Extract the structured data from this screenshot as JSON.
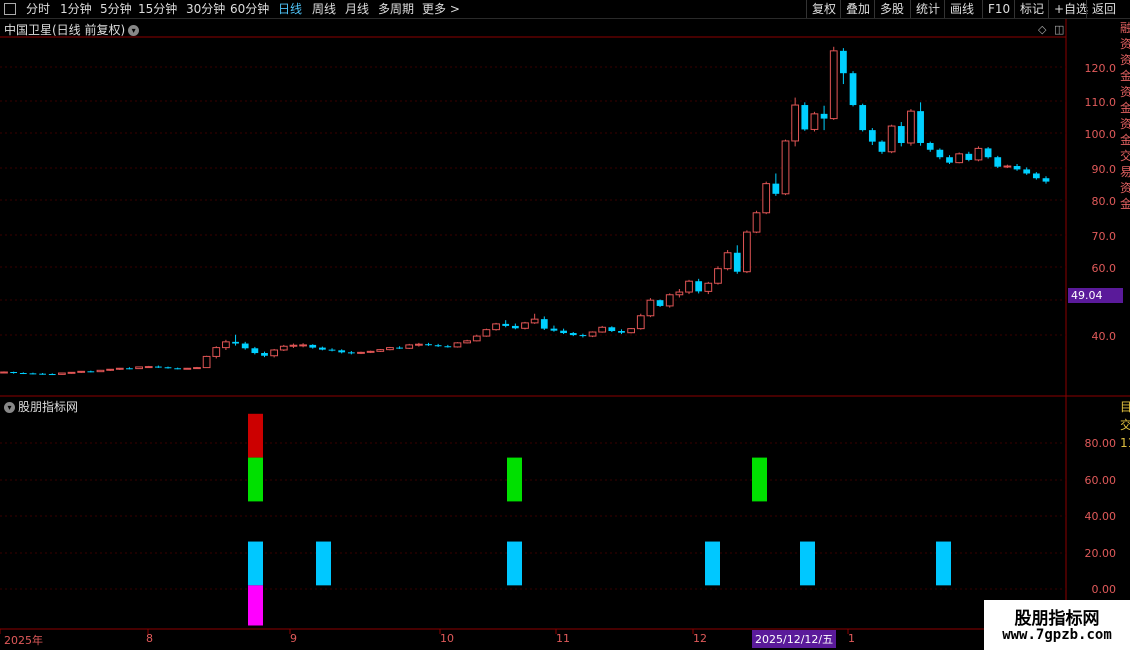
{
  "toolbar": {
    "periods": [
      "分时",
      "1分钟",
      "5分钟",
      "15分钟",
      "30分钟",
      "60分钟",
      "日线",
      "周线",
      "月线",
      "多周期",
      "更多 >"
    ],
    "active_period": "日线",
    "right_buttons": [
      "复权",
      "叠加",
      "多股",
      "统计",
      "画线",
      "F10",
      "标记",
      "+自选",
      "返回"
    ]
  },
  "main_title": "中国卫星(日线 前复权)",
  "price_labels": [
    "120.0",
    "110.0",
    "100.0",
    "90.0",
    "80.0",
    "70.0",
    "60.0",
    "40.0"
  ],
  "current_price": "49.04",
  "indicator_title": "股朋指标网",
  "indicator_labels": [
    "80.00",
    "60.00",
    "40.00",
    "20.00",
    "0.00"
  ],
  "x_labels": [
    "2025年",
    "8",
    "9",
    "10",
    "11",
    "12",
    "1"
  ],
  "x_date_badge": "2025/12/12/五",
  "side_chars": "融资资金资金资金交易资金",
  "side_chars2": "目交1111111",
  "watermark": {
    "line1": "股朋指标网",
    "line2": "www.7gpzb.com"
  },
  "colors": {
    "up": "#e05555",
    "down": "#00d0ff",
    "grid": "#3a0000",
    "sep": "#8b0000"
  },
  "chart_data": {
    "type": "candlestick",
    "ylim": [
      30,
      128
    ],
    "candles": [
      [
        29.8,
        30.2,
        29.6,
        30.0
      ],
      [
        30.0,
        30.1,
        29.5,
        29.7
      ],
      [
        29.7,
        29.9,
        29.4,
        29.6
      ],
      [
        29.6,
        29.8,
        29.3,
        29.5
      ],
      [
        29.5,
        29.7,
        29.2,
        29.4
      ],
      [
        29.4,
        29.6,
        29.1,
        29.3
      ],
      [
        29.3,
        29.8,
        29.2,
        29.7
      ],
      [
        29.7,
        30.0,
        29.5,
        29.9
      ],
      [
        29.9,
        30.3,
        29.7,
        30.2
      ],
      [
        30.2,
        30.4,
        29.9,
        30.1
      ],
      [
        30.1,
        30.6,
        30.0,
        30.5
      ],
      [
        30.5,
        30.9,
        30.3,
        30.8
      ],
      [
        30.8,
        31.2,
        30.6,
        31.1
      ],
      [
        31.1,
        31.4,
        30.8,
        31.0
      ],
      [
        31.0,
        31.6,
        30.9,
        31.5
      ],
      [
        31.5,
        31.8,
        31.2,
        31.6
      ],
      [
        31.6,
        31.9,
        31.2,
        31.4
      ],
      [
        31.4,
        31.6,
        31.0,
        31.1
      ],
      [
        31.1,
        31.3,
        30.8,
        31.0
      ],
      [
        31.0,
        31.2,
        30.8,
        31.1
      ],
      [
        31.1,
        31.5,
        30.9,
        31.3
      ],
      [
        31.3,
        34.8,
        31.2,
        34.6
      ],
      [
        34.6,
        37.6,
        34.0,
        37.2
      ],
      [
        37.2,
        39.5,
        36.5,
        38.9
      ],
      [
        38.9,
        41.0,
        37.8,
        38.4
      ],
      [
        38.4,
        38.9,
        36.6,
        37.0
      ],
      [
        37.0,
        37.4,
        35.2,
        35.6
      ],
      [
        35.6,
        36.0,
        34.4,
        34.8
      ],
      [
        34.8,
        36.8,
        34.3,
        36.5
      ],
      [
        36.5,
        38.0,
        36.2,
        37.6
      ],
      [
        37.6,
        38.4,
        37.1,
        37.9
      ],
      [
        37.9,
        38.5,
        37.3,
        38.0
      ],
      [
        38.0,
        38.2,
        36.9,
        37.2
      ],
      [
        37.2,
        37.5,
        36.4,
        36.6
      ],
      [
        36.6,
        37.0,
        36.1,
        36.4
      ],
      [
        36.4,
        36.7,
        35.5,
        35.8
      ],
      [
        35.8,
        36.2,
        35.2,
        35.5
      ],
      [
        35.5,
        36.0,
        35.3,
        35.8
      ],
      [
        35.8,
        36.3,
        35.6,
        36.1
      ],
      [
        36.1,
        36.8,
        35.9,
        36.6
      ],
      [
        36.6,
        37.4,
        36.4,
        37.2
      ],
      [
        37.2,
        37.6,
        36.8,
        37.0
      ],
      [
        37.0,
        38.3,
        36.8,
        38.0
      ],
      [
        38.0,
        38.6,
        37.5,
        38.2
      ],
      [
        38.2,
        38.6,
        37.7,
        37.9
      ],
      [
        37.9,
        38.3,
        37.4,
        37.6
      ],
      [
        37.6,
        38.0,
        37.2,
        37.4
      ],
      [
        37.4,
        38.8,
        37.2,
        38.6
      ],
      [
        38.6,
        39.5,
        38.4,
        39.2
      ],
      [
        39.2,
        41.0,
        39.0,
        40.6
      ],
      [
        40.6,
        42.8,
        40.4,
        42.5
      ],
      [
        42.5,
        44.5,
        42.2,
        44.2
      ],
      [
        44.2,
        45.3,
        43.2,
        43.6
      ],
      [
        43.6,
        44.3,
        42.6,
        42.9
      ],
      [
        42.9,
        44.8,
        42.6,
        44.5
      ],
      [
        44.5,
        47.2,
        44.2,
        45.6
      ],
      [
        45.6,
        46.4,
        42.4,
        42.8
      ],
      [
        42.8,
        43.7,
        41.9,
        42.2
      ],
      [
        42.2,
        42.8,
        41.2,
        41.5
      ],
      [
        41.5,
        41.8,
        40.6,
        40.9
      ],
      [
        40.9,
        41.3,
        40.2,
        40.6
      ],
      [
        40.6,
        42.0,
        40.3,
        41.8
      ],
      [
        41.8,
        43.6,
        41.6,
        43.2
      ],
      [
        43.2,
        43.5,
        41.8,
        42.1
      ],
      [
        42.1,
        42.6,
        41.2,
        41.6
      ],
      [
        41.6,
        43.0,
        41.4,
        42.8
      ],
      [
        42.8,
        47.2,
        42.5,
        46.6
      ],
      [
        46.6,
        51.8,
        46.2,
        51.2
      ],
      [
        51.2,
        51.4,
        49.2,
        49.5
      ],
      [
        49.5,
        53.2,
        49.0,
        52.8
      ],
      [
        52.8,
        54.5,
        52.0,
        53.6
      ],
      [
        53.6,
        57.2,
        53.0,
        56.8
      ],
      [
        56.8,
        57.5,
        53.2,
        53.8
      ],
      [
        53.8,
        56.6,
        53.0,
        56.2
      ],
      [
        56.2,
        61.2,
        55.8,
        60.5
      ],
      [
        60.5,
        66.0,
        60.0,
        65.2
      ],
      [
        65.2,
        67.4,
        59.0,
        59.6
      ],
      [
        59.6,
        71.8,
        59.2,
        71.3
      ],
      [
        71.3,
        77.6,
        71.0,
        77.0
      ],
      [
        77.0,
        86.2,
        76.6,
        85.6
      ],
      [
        85.6,
        88.6,
        82.0,
        82.6
      ],
      [
        82.6,
        98.6,
        82.2,
        98.2
      ],
      [
        98.2,
        111.0,
        96.6,
        108.8
      ],
      [
        108.8,
        109.6,
        101.2,
        101.6
      ],
      [
        101.6,
        106.8,
        101.0,
        106.2
      ],
      [
        106.2,
        108.6,
        101.4,
        104.8
      ],
      [
        104.8,
        126.0,
        104.4,
        124.8
      ],
      [
        124.8,
        125.6,
        115.0,
        118.2
      ],
      [
        118.2,
        118.8,
        108.4,
        108.8
      ],
      [
        108.8,
        109.2,
        101.0,
        101.4
      ],
      [
        101.4,
        102.0,
        97.0,
        98.0
      ],
      [
        98.0,
        98.4,
        94.4,
        95.0
      ],
      [
        95.0,
        103.0,
        94.6,
        102.6
      ],
      [
        102.6,
        103.8,
        96.6,
        97.6
      ],
      [
        97.6,
        107.6,
        96.8,
        107.0
      ],
      [
        107.0,
        109.6,
        96.8,
        97.6
      ],
      [
        97.6,
        98.0,
        95.0,
        95.6
      ],
      [
        95.6,
        96.0,
        92.8,
        93.4
      ],
      [
        93.4,
        94.0,
        91.4,
        91.8
      ],
      [
        91.8,
        94.8,
        91.6,
        94.4
      ],
      [
        94.4,
        95.0,
        92.2,
        92.6
      ],
      [
        92.6,
        96.6,
        92.2,
        96.0
      ],
      [
        96.0,
        96.4,
        93.0,
        93.4
      ],
      [
        93.4,
        93.8,
        90.2,
        90.6
      ],
      [
        90.6,
        91.2,
        90.2,
        90.8
      ],
      [
        90.8,
        91.4,
        89.4,
        89.8
      ],
      [
        89.8,
        90.4,
        88.2,
        88.6
      ],
      [
        88.6,
        89.0,
        86.8,
        87.2
      ],
      [
        87.2,
        87.8,
        85.6,
        86.2
      ]
    ]
  },
  "indicator_data": {
    "type": "bar",
    "ylim": [
      -20,
      100
    ],
    "red_blocks": [
      {
        "x_index": 0,
        "from": 72,
        "to": 96
      }
    ],
    "green_blocks": [
      {
        "from": 48,
        "to": 72
      }
    ],
    "cyan_blocks": [
      {
        "from": 2,
        "to": 26
      }
    ],
    "magenta_blocks": [
      {
        "from": -20,
        "to": 2
      }
    ]
  }
}
